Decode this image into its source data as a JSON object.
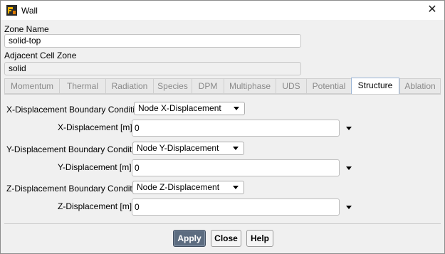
{
  "window": {
    "title": "Wall"
  },
  "zone": {
    "name_label": "Zone Name",
    "name_value": "solid-top",
    "adjacent_label": "Adjacent Cell Zone",
    "adjacent_value": "solid"
  },
  "tabs": [
    {
      "label": "Momentum",
      "active": false
    },
    {
      "label": "Thermal",
      "active": false
    },
    {
      "label": "Radiation",
      "active": false
    },
    {
      "label": "Species",
      "active": false
    },
    {
      "label": "DPM",
      "active": false
    },
    {
      "label": "Multiphase",
      "active": false
    },
    {
      "label": "UDS",
      "active": false
    },
    {
      "label": "Potential",
      "active": false
    },
    {
      "label": "Structure",
      "active": true
    },
    {
      "label": "Ablation",
      "active": false
    }
  ],
  "structure": {
    "x_bc_label": "X-Displacement Boundary Condition",
    "x_bc_value": "Node X-Displacement",
    "x_label": "X-Displacement [m]",
    "x_value": "0",
    "y_bc_label": "Y-Displacement Boundary Condition",
    "y_bc_value": "Node Y-Displacement",
    "y_label": "Y-Displacement [m]",
    "y_value": "0",
    "z_bc_label": "Z-Displacement Boundary Condition",
    "z_bc_value": "Node Z-Displacement",
    "z_label": "Z-Displacement [m]",
    "z_value": "0"
  },
  "buttons": {
    "apply": "Apply",
    "close": "Close",
    "help": "Help"
  },
  "icons": {
    "app": "ansys-fluent-icon",
    "close": "close-icon",
    "dropdown": "chevron-down-icon"
  }
}
